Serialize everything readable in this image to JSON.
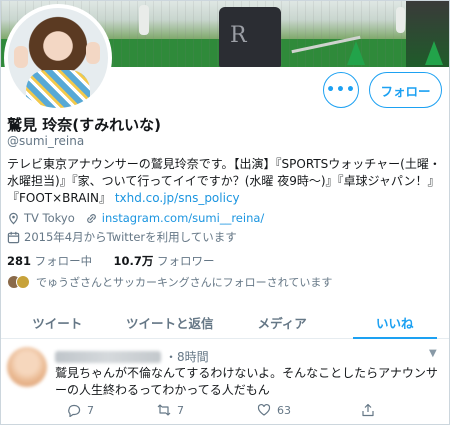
{
  "profile": {
    "display_name": "鷲見 玲奈(すみれいな)",
    "handle": "@sumi_reina",
    "bio_text": "テレビ東京アナウンサーの鷲見玲奈です。【出演】『SPORTSウォッチャー(土曜・水曜担当)』『家、ついて行ってイイですか？(水曜 夜9時〜)』『卓球ジャパン！』『FOOT×BRAIN』",
    "bio_link": "txhd.co.jp/sns_policy",
    "location": "TV Tokyo",
    "website": "instagram.com/sumi__reina/",
    "joined": "2015年4月からTwitterを利用しています",
    "following_count": "281",
    "following_label": "フォロー中",
    "followers_count": "10.7万",
    "followers_label": "フォロワー",
    "followed_by": "でゅうざさんとサッカーキングさんにフォローされています"
  },
  "banner": {
    "bag_letter": "R"
  },
  "buttons": {
    "more": "•••",
    "follow": "フォロー"
  },
  "tabs": [
    {
      "label": "ツイート",
      "active": false
    },
    {
      "label": "ツイートと返信",
      "active": false
    },
    {
      "label": "メディア",
      "active": false
    },
    {
      "label": "いいね",
      "active": true
    }
  ],
  "tweet": {
    "time": "・8時間",
    "text": "鷲見ちゃんが不倫なんてするわけないよ。そんなことしたらアナウンサーの人生終わるってわかってる人だもん",
    "reply_count": "7",
    "retweet_count": "7",
    "like_count": "63"
  },
  "colors": {
    "accent": "#1da1f2",
    "link": "#1b95e0",
    "muted": "#657786"
  }
}
